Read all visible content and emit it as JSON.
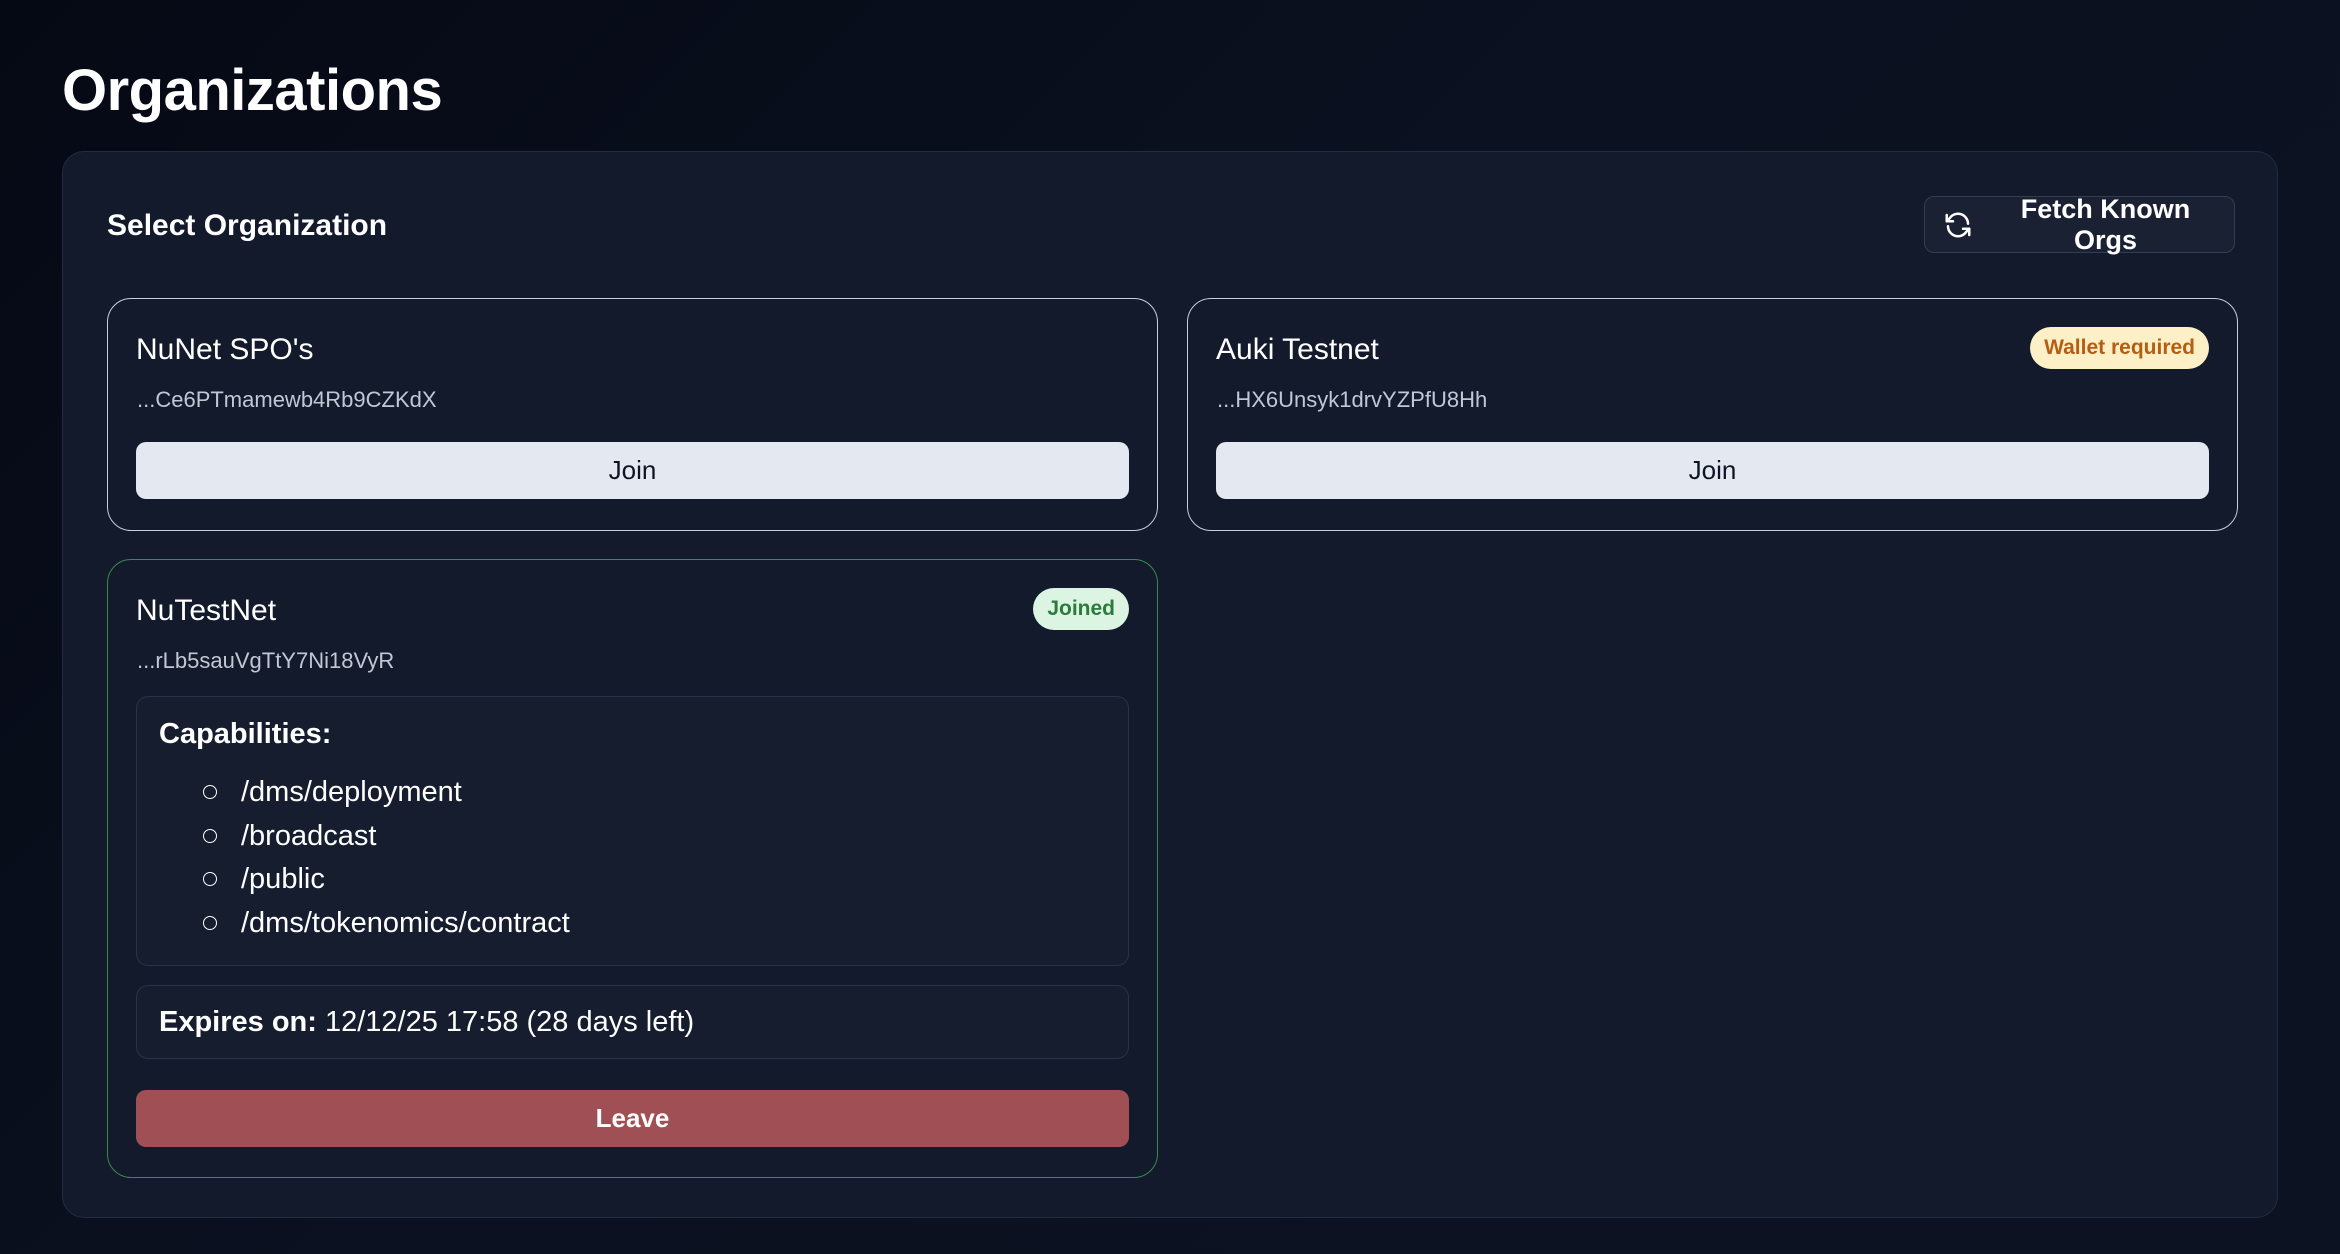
{
  "page": {
    "title": "Organizations"
  },
  "panel": {
    "title": "Select Organization",
    "fetch_button_label": "Fetch Known Orgs"
  },
  "organizations": [
    {
      "name": "NuNet SPO's",
      "id": "...Ce6PTmamewb4Rb9CZKdX",
      "badge": "",
      "action_label": "Join"
    },
    {
      "name": "Auki Testnet",
      "id": "...HX6Unsyk1drvYZPfU8Hh",
      "badge": "Wallet required",
      "action_label": "Join"
    },
    {
      "name": "NuTestNet",
      "id": "...rLb5sauVgTtY7Ni18VyR",
      "badge": "Joined",
      "capabilities_title": "Capabilities:",
      "capabilities": [
        "/dms/deployment",
        "/broadcast",
        "/public",
        "/dms/tokenomics/contract"
      ],
      "expires_label": "Expires on:",
      "expires_value": "12/12/25 17:58 (28 days left)",
      "action_label": "Leave"
    }
  ],
  "colors": {
    "background": "#070b17",
    "panel": "#121a2c",
    "joined_border": "#3a8a4e",
    "leave_button": "#a05055",
    "join_button": "#e4e8f0",
    "warn_badge_bg": "#fdf0c6",
    "warn_badge_text": "#b65d14",
    "ok_badge_bg": "#dcf5e3",
    "ok_badge_text": "#2c7a3c"
  },
  "icons": {
    "fetch": "refresh-icon",
    "capability_bullet": "hollow-circle"
  }
}
